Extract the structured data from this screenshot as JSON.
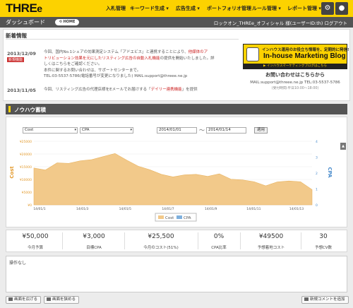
{
  "app": {
    "logo": "THREe",
    "nav": [
      "入札管理",
      "キーワード生成 ▾",
      "広告生成 ▾",
      "ポートフォリオ管理",
      "ルール管理 ▾",
      "レポート管理 ▾"
    ],
    "page_title": "ダッシュボード",
    "home_label": "HOME",
    "user_text": "ロックオン_THREe_オフィシャル 様(ユーザーID:th)  ログアウト"
  },
  "news": {
    "heading": "新着情報",
    "items": [
      {
        "date": "2013/12/09",
        "badge": "新規機能",
        "line1": "今回、国内No.1シェアの効果測定システム「アドエビス」と連携することにより、",
        "line1_red": "他媒体のア",
        "line2_red": "トリビューション効果を元にしたリスティング広告の自動入札機能",
        "line2": "の提供を開始いたしました。詳",
        "line3": "しくはこちらをご確認ください。",
        "line4": "本件に関するお問い合わせは、サポートセンターまで。",
        "line5": "TEL:03-5537-5786(電話番号が変更になりました) MAIL:support@threee.ne.jp"
      },
      {
        "date": "2013/11/05",
        "line1": "今回、リスティング広告の代理店様をEメールでお届けする「",
        "line1_red": "デイリー連携機能",
        "line1_end": "」を提供"
      }
    ]
  },
  "banner": {
    "line1": "インハウス運用のお役立ち情報を、定期的に発信!",
    "line2": "In-house Marketing Blog",
    "line3": "▶ インハウスマーケティングブログはこちら"
  },
  "contact": {
    "title": "お問い合わせはこちらから",
    "line": "MAIL:support@threee.ne.jp  TEL:03-5537-5786",
    "hours": "(受付時間:平日10:00～18:00)"
  },
  "knowhow": {
    "title": "ノウハウ蓄積",
    "select1": "Cost",
    "select2": "CPA",
    "date_from": "2014/01/01",
    "date_to": "2014/01/14",
    "apply": "適用",
    "tilde": "～"
  },
  "chart_data": {
    "type": "area",
    "ylabel": "Cost",
    "y2label": "CPA",
    "y_ticks": [
      "¥25000",
      "¥20000",
      "¥15000",
      "¥10000",
      "¥5000",
      "¥0"
    ],
    "y2_ticks": [
      "4",
      "3",
      "2",
      "1",
      "0"
    ],
    "x_ticks": [
      "14/01/1",
      "14/01/3",
      "14/01/5",
      "14/01/7",
      "14/01/9",
      "14/01/11",
      "14/01/13"
    ],
    "ylim": [
      0,
      25000
    ],
    "series": [
      {
        "name": "Cost",
        "values": [
          14500,
          13700,
          16500,
          16300,
          17300,
          17800,
          19000,
          20200,
          17600,
          15200,
          13800,
          12000,
          11000,
          11800,
          12000,
          11200,
          12200,
          10100,
          9800,
          9100,
          7500,
          9000,
          9400,
          9100,
          6000
        ]
      },
      {
        "name": "CPA",
        "values": []
      }
    ],
    "legend": [
      "Cost",
      "CPA"
    ],
    "legend_position": "bottom",
    "colors": {
      "cost": "#f2c98a",
      "cpa": "#7fb0dd"
    }
  },
  "stats": [
    {
      "value": "¥50,000",
      "label": "今月予算"
    },
    {
      "value": "¥3,000",
      "label": "目標CPA"
    },
    {
      "value": "¥25,500",
      "label": "今月のコスト(51%)"
    },
    {
      "value": "0%",
      "label": "CPA比率"
    },
    {
      "value": "¥49500",
      "label": "予想着地コスト"
    },
    {
      "value": "30",
      "label": "予想CV数"
    }
  ],
  "memo": {
    "text": "操作なし"
  },
  "footer": {
    "btn1": "画面を広げる",
    "btn2": "画面を狭める",
    "btn3": "新規コメントを追加"
  }
}
